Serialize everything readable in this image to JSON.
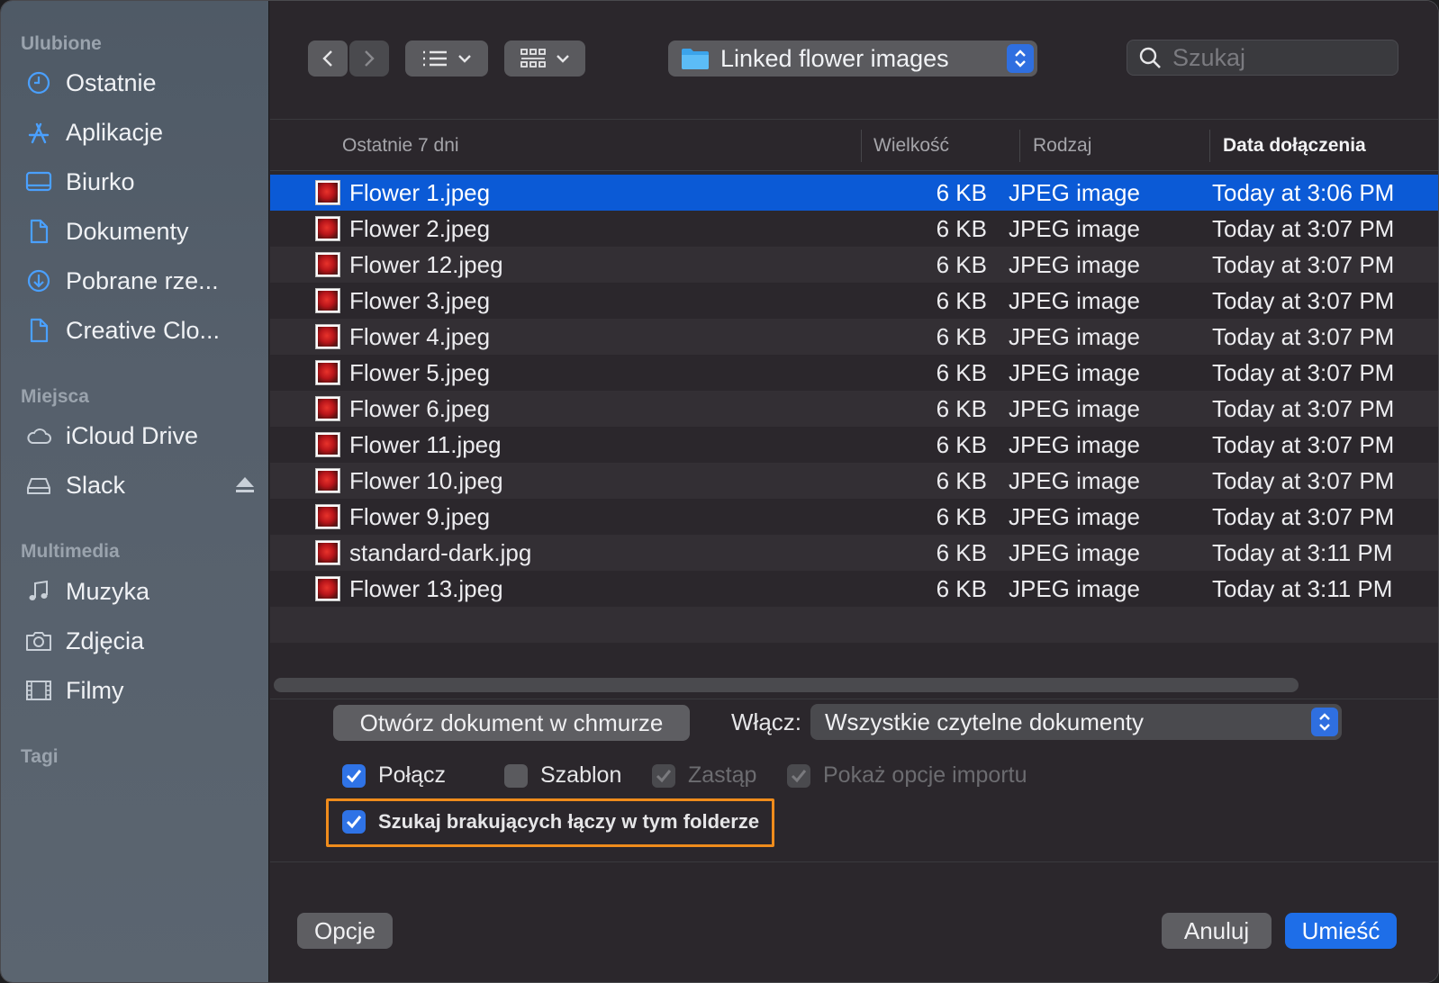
{
  "sidebar": {
    "sections": [
      {
        "title": "Ulubione"
      },
      {
        "title": "Miejsca"
      },
      {
        "title": "Multimedia"
      },
      {
        "title": "Tagi"
      }
    ],
    "favorites": [
      {
        "label": "Ostatnie",
        "icon": "clock-icon"
      },
      {
        "label": "Aplikacje",
        "icon": "apps-icon"
      },
      {
        "label": "Biurko",
        "icon": "desktop-icon"
      },
      {
        "label": "Dokumenty",
        "icon": "document-icon"
      },
      {
        "label": "Pobrane rze...",
        "icon": "download-icon"
      },
      {
        "label": "Creative Clo...",
        "icon": "document-icon"
      }
    ],
    "places": [
      {
        "label": "iCloud Drive",
        "icon": "cloud-icon"
      },
      {
        "label": "Slack",
        "icon": "drive-icon"
      }
    ],
    "media": [
      {
        "label": "Muzyka",
        "icon": "music-icon"
      },
      {
        "label": "Zdjęcia",
        "icon": "camera-icon"
      },
      {
        "label": "Filmy",
        "icon": "film-icon"
      }
    ]
  },
  "toolbar": {
    "current_folder": "Linked flower images",
    "search_placeholder": "Szukaj"
  },
  "columns": {
    "name": "Ostatnie 7 dni",
    "size": "Wielkość",
    "kind": "Rodzaj",
    "date": "Data dołączenia"
  },
  "files": [
    {
      "name": "Flower 1.jpeg",
      "size": "6 KB",
      "kind": "JPEG image",
      "date": "Today at 3:06 PM",
      "selected": true
    },
    {
      "name": "Flower 2.jpeg",
      "size": "6 KB",
      "kind": "JPEG image",
      "date": "Today at 3:07 PM"
    },
    {
      "name": "Flower 12.jpeg",
      "size": "6 KB",
      "kind": "JPEG image",
      "date": "Today at 3:07 PM"
    },
    {
      "name": "Flower 3.jpeg",
      "size": "6 KB",
      "kind": "JPEG image",
      "date": "Today at 3:07 PM"
    },
    {
      "name": "Flower 4.jpeg",
      "size": "6 KB",
      "kind": "JPEG image",
      "date": "Today at 3:07 PM"
    },
    {
      "name": "Flower 5.jpeg",
      "size": "6 KB",
      "kind": "JPEG image",
      "date": "Today at 3:07 PM"
    },
    {
      "name": "Flower 6.jpeg",
      "size": "6 KB",
      "kind": "JPEG image",
      "date": "Today at 3:07 PM"
    },
    {
      "name": "Flower 11.jpeg",
      "size": "6 KB",
      "kind": "JPEG image",
      "date": "Today at 3:07 PM"
    },
    {
      "name": "Flower 10.jpeg",
      "size": "6 KB",
      "kind": "JPEG image",
      "date": "Today at 3:07 PM"
    },
    {
      "name": "Flower 9.jpeg",
      "size": "6 KB",
      "kind": "JPEG image",
      "date": "Today at 3:07 PM"
    },
    {
      "name": "standard-dark.jpg",
      "size": "6 KB",
      "kind": "JPEG image",
      "date": "Today at 3:11 PM"
    },
    {
      "name": "Flower 13.jpeg",
      "size": "6 KB",
      "kind": "JPEG image",
      "date": "Today at 3:11 PM"
    }
  ],
  "options": {
    "open_cloud_label": "Otwórz dokument w chmurze",
    "enable_label": "Włącz:",
    "enable_value": "Wszystkie czytelne dokumenty",
    "link_label": "Połącz",
    "template_label": "Szablon",
    "replace_label": "Zastąp",
    "import_options_label": "Pokaż opcje importu",
    "search_missing_label": "Szukaj brakujących łączy w tym folderze"
  },
  "footer": {
    "options_label": "Opcje",
    "cancel_label": "Anuluj",
    "place_label": "Umieść"
  },
  "colors": {
    "accent": "#1e6ee8",
    "selection": "#0b5ad6",
    "highlight_border": "#f08c1c"
  }
}
